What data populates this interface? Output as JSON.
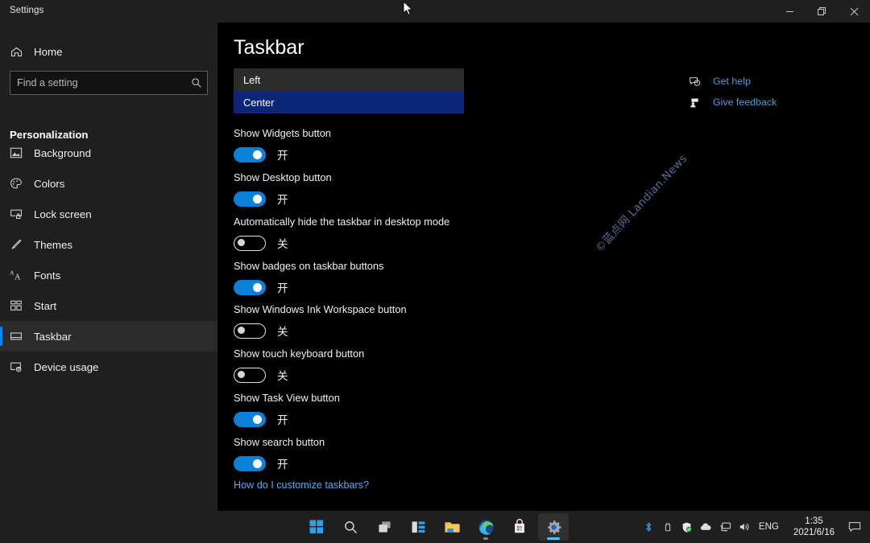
{
  "window": {
    "title": "Settings",
    "controls": [
      {
        "name": "minimize",
        "glyph": "minimize-icon"
      },
      {
        "name": "restore",
        "glyph": "restore-icon"
      },
      {
        "name": "close",
        "glyph": "close-icon"
      }
    ]
  },
  "sidebar": {
    "home_label": "Home",
    "search": {
      "value": "",
      "placeholder": "Find a setting",
      "icon": "search-icon"
    },
    "group_title": "Personalization",
    "items": [
      {
        "label": "Background",
        "icon": "image-icon",
        "selected": false
      },
      {
        "label": "Colors",
        "icon": "palette-icon",
        "selected": false
      },
      {
        "label": "Lock screen",
        "icon": "lock-screen-icon",
        "selected": false
      },
      {
        "label": "Themes",
        "icon": "brush-icon",
        "selected": false
      },
      {
        "label": "Fonts",
        "icon": "fonts-icon",
        "selected": false
      },
      {
        "label": "Start",
        "icon": "start-icon",
        "selected": false
      },
      {
        "label": "Taskbar",
        "icon": "taskbar-icon",
        "selected": true
      },
      {
        "label": "Device usage",
        "icon": "device-usage-icon",
        "selected": false
      }
    ]
  },
  "main": {
    "page_title": "Taskbar",
    "alignment_dropdown": {
      "options": [
        {
          "label": "Left",
          "selected": false
        },
        {
          "label": "Center",
          "selected": true
        }
      ]
    },
    "settings": [
      {
        "label": "Show Widgets button",
        "state": "on",
        "state_label": "开"
      },
      {
        "label": "Show Desktop button",
        "state": "on",
        "state_label": "开"
      },
      {
        "label": "Automatically hide the taskbar in desktop mode",
        "state": "off",
        "state_label": "关"
      },
      {
        "label": "Show badges on taskbar buttons",
        "state": "on",
        "state_label": "开"
      },
      {
        "label": "Show Windows Ink Workspace button",
        "state": "off",
        "state_label": "关"
      },
      {
        "label": "Show touch keyboard button",
        "state": "off",
        "state_label": "关"
      },
      {
        "label": "Show Task View button",
        "state": "on",
        "state_label": "开"
      },
      {
        "label": "Show search button",
        "state": "on",
        "state_label": "开"
      }
    ],
    "help_link": "How do I customize taskbars?",
    "help_column": [
      {
        "label": "Get help",
        "icon": "help-chat-icon"
      },
      {
        "label": "Give feedback",
        "icon": "feedback-icon"
      }
    ],
    "watermark": "©蓝点网 Landian.News"
  },
  "taskbar": {
    "apps": [
      {
        "name": "start",
        "icon": "windows-start-icon",
        "active": false,
        "indicator": "none"
      },
      {
        "name": "search",
        "icon": "search-icon",
        "active": false,
        "indicator": "none"
      },
      {
        "name": "task-view",
        "icon": "task-view-icon",
        "active": false,
        "indicator": "none"
      },
      {
        "name": "widgets",
        "icon": "widgets-icon",
        "active": false,
        "indicator": "none"
      },
      {
        "name": "file-explorer",
        "icon": "folder-icon",
        "active": false,
        "indicator": "none"
      },
      {
        "name": "edge",
        "icon": "edge-icon",
        "active": false,
        "indicator": "dot"
      },
      {
        "name": "microsoft-store",
        "icon": "store-icon",
        "active": false,
        "indicator": "none"
      },
      {
        "name": "settings",
        "icon": "gear-icon",
        "active": true,
        "indicator": "bar"
      }
    ],
    "tray": [
      {
        "name": "bluetooth",
        "icon": "bluetooth-icon"
      },
      {
        "name": "usb",
        "icon": "usb-icon"
      },
      {
        "name": "windows-security",
        "icon": "shield-icon"
      },
      {
        "name": "onedrive",
        "icon": "cloud-icon"
      },
      {
        "name": "network",
        "icon": "network-icon"
      },
      {
        "name": "volume",
        "icon": "volume-icon"
      }
    ],
    "language": "ENG",
    "clock": {
      "time": "1:35",
      "date": "2021/6/16"
    },
    "notification_icon": "notification-icon"
  },
  "colors": {
    "accent": "#0a80d8",
    "link": "#4c9fe0",
    "selection": "#0c2577",
    "sidebar_bg": "#1f1f1f",
    "content_bg": "#000000"
  }
}
